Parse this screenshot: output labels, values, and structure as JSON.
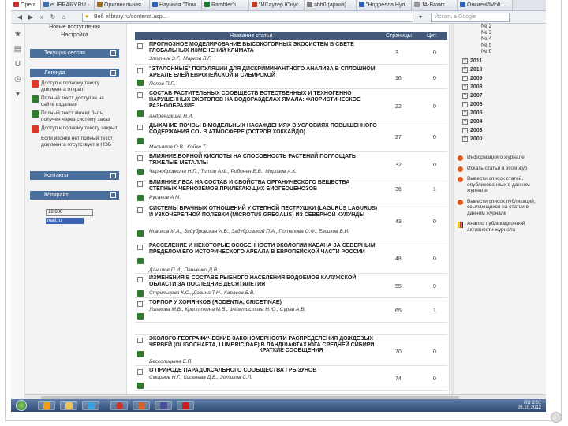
{
  "tabs": [
    {
      "label": "Opera",
      "color": "#d32f2f"
    },
    {
      "label": "eLIBRARY.RU -",
      "color": "#3b6fb6"
    },
    {
      "label": "Оригинальная...",
      "color": "#9c6b1f"
    },
    {
      "label": "Научная \"Тюм...",
      "color": "#2b63b8"
    },
    {
      "label": "Rambler's",
      "color": "#1b7d2e"
    },
    {
      "label": "\"ИСаутер Юнус...",
      "color": "#c23b22"
    },
    {
      "label": "abh0 (архив)...",
      "color": "#7a7a7a"
    },
    {
      "label": "\"Нодрелла Нул...",
      "color": "#2b63b8"
    },
    {
      "label": "JA-Вахит...",
      "color": "#999999"
    },
    {
      "label": "ОнкиенИМоlt ...",
      "color": "#2b63b8"
    }
  ],
  "toolbar": {
    "address_prefix": "Веб",
    "address": "elibrary.ru/contents.asp...",
    "search_placeholder": "Искать в Google"
  },
  "left_sidebar": {
    "top_links": [
      "Новые поступления",
      "Настройка"
    ],
    "panel_session": "Текущая сессия",
    "panel_legend": "Легенда",
    "legend_items": [
      {
        "text": "Доступ к полному тексту документа открыт",
        "color": "#d63a2a"
      },
      {
        "text": "Полный текст доступен на сайте издателя",
        "color": "#2f7a2f"
      },
      {
        "text": "Полный текст может быть получен через систему заказ",
        "color": "#2f7a2f"
      },
      {
        "text": "Доступ к полному тексту закрыт",
        "color": "#d63a2a"
      },
      {
        "text": "Если иконки нет полный текст документа отсутствует в НЭБ",
        "color": ""
      }
    ],
    "panel_contacts": "Контакты",
    "panel_copyright": "Копирайт",
    "counter_text": "18 808",
    "mailru_text": "mail.ru"
  },
  "table": {
    "col_title": "Название статьи",
    "col_pages": "Страницы",
    "col_citations": "Цит.",
    "rows": [
      {
        "title": "ПРОГНОЗНОЕ МОДЕЛИРОВАНИЕ ВЫСОКОГОРНЫХ ЭКОСИСТЕМ В СВЕТЕ ГЛОБАЛЬНЫХ ИЗМЕНЕНИЙ КЛИМАТА",
        "authors": "Злотник Э.Г., Марков Л.Г.",
        "pages": "3",
        "citations": "0"
      },
      {
        "title": "\"ЭТАЛОННЫЕ\" ПОПУЛЯЦИИ ДЛЯ ДИСКРИМИНАНТНОГО АНАЛИЗА В СПЛОШНОМ АРЕАЛЕ ЕЛЕЙ ЕВРОПЕЙСКОЙ И СИБИРСКОЙ",
        "authors": "Попов П.П.",
        "pages": "16",
        "citations": "0"
      },
      {
        "title": "СОСТАВ РАСТИТЕЛЬНЫХ СООБЩЕСТВ ЕСТЕСТВЕННЫХ И ТЕХНОГЕННО НАРУШЕННЫХ ЭКОТОПОВ НА ВОДОРАЗДЕЛАХ ЯМАЛА: ФЛОРИСТИЧЕСКОЕ РАЗНООБРАЗИЕ",
        "authors": "Андреяшкина Н.И.",
        "pages": "22",
        "citations": "0"
      },
      {
        "title": "ДЫХАНИЕ ПОЧВЫ В МОДЕЛЬНЫХ НАСАЖДЕНИЯХ В УСЛОВИЯХ ПОВЫШЕННОГО СОДЕРЖАНИЯ CO₂ В АТМОСФЕРЕ (ОСТРОВ ХОККАЙДО)",
        "authors": "Масьянов О.В., Койке Т.",
        "pages": "27",
        "citations": "0"
      },
      {
        "title": "ВЛИЯНИЕ БОРНОЙ КИСЛОТЫ НА СПОСОБНОСТЬ РАСТЕНИЙ ПОГЛОЩАТЬ ТЯЖЕЛЫЕ МЕТАЛЛЫ",
        "authors": "Чернобровкина Н.П., Титов А.Ф., Робонен Е.В., Морозов А.К.",
        "pages": "32",
        "citations": "0"
      },
      {
        "title": "ВЛИЯНИЕ ЛЕСА НА СОСТАВ И СВОЙСТВА ОРГАНИЧЕСКОГО ВЕЩЕСТВА СТЕПНЫХ ЧЕРНОЗЕМОВ ПРИЛЕГАЮЩИХ БИОГЕОЦЕНОЗОВ",
        "authors": "Русанов А.М.",
        "pages": "36",
        "citations": "1"
      },
      {
        "title": "СИСТЕМЫ БРАЧНЫХ ОТНОШЕНИЙ У СТЕПНОЙ ПЕСТРУШКИ (LAGURUS LAGURUS) И УЗКОЧЕРЕПНОЙ ПОЛЕВКИ (MICROTUS GREGALIS) ИЗ СЕВЕРНОЙ КУЛУНДЫ",
        "authors": "Новиков М.А., Задубровская И.В., Задубровский П.А., Потапова О.Ф., Евсиков В.И.",
        "pages": "43",
        "citations": "0"
      },
      {
        "title": "РАССЕЛЕНИЕ И НЕКОТОРЫЕ ОСОБЕННОСТИ ЭКОЛОГИИ КАБАНА ЗА СЕВЕРНЫМ ПРЕДЕЛОМ ЕГО ИСТОРИЧЕСКОГО АРЕАЛА В ЕВРОПЕЙСКОЙ ЧАСТИ РОССИИ",
        "authors": "Данилов П.И., Панченко Д.В.",
        "pages": "48",
        "citations": "0"
      },
      {
        "title": "ИЗМЕНЕНИЯ В СОСТАВЕ РЫБНОГО НАСЕЛЕНИЯ ВОДОЕМОВ КАЛУЖСКОЙ ОБЛАСТИ ЗА ПОСЛЕДНИЕ ДЕСЯТИЛЕТИЯ",
        "authors": "Стрельцова К.С., Дэвина Т.Н., Карасев В.В.",
        "pages": "55",
        "citations": "0"
      },
      {
        "title": "ТОРПОР У ХОМЯЧКОВ (RODENTIA, CRICETINAE)",
        "authors": "Ушакова М.В., Кропоткина М.В., Феоктистова Н.Ю., Сурав А.В.",
        "pages": "65",
        "citations": "1"
      },
      {
        "title": "ЭКОЛОГО-ГЕОГРАФИЧЕСКИЕ ЗАКОНОМЕРНОСТИ РАСПРЕДЕЛЕНИЯ ДОЖДЕВЫХ ЧЕРВЕЙ (OLIGOCHAETA, LUMBRICIDAE) В ЛАНДШАФТАХ ЮГА СРЕДНЕЙ СИБИРИ",
        "authors": "Бессолицына Е.П.",
        "pages": "70",
        "citations": "0"
      },
      {
        "title": "О ПРИРОДЕ ПАРАДОКСАЛЬНОГО СООБЩЕСТВА ГРЫЗУНОВ",
        "authors": "Смирнов Н.Г., Киселева Д.В., Зотиков С.Л.",
        "pages": "74",
        "citations": "0"
      }
    ],
    "section_short": "КРАТКИЕ СООБЩЕНИЯ"
  },
  "right_sidebar": {
    "issues": [
      "№ 2",
      "№ 3",
      "№ 4",
      "№ 5",
      "№ 6"
    ],
    "years": [
      "2011",
      "2010",
      "2009",
      "2008",
      "2007",
      "2006",
      "2005",
      "2004",
      "2003",
      "2000"
    ],
    "links": [
      {
        "text": "Информация о журнале",
        "icon": "dot"
      },
      {
        "text": "Искать статьи в этом жур",
        "icon": "dot"
      },
      {
        "text": "Вывести список статей, опубликованных в данном журнале",
        "icon": "dot"
      },
      {
        "text": "Вывести список публикаций, ссылающихся на статьи в данном журнале",
        "icon": "dot"
      },
      {
        "text": "Анализ публикационной активности журнала",
        "icon": "bars"
      }
    ]
  },
  "taskbar": {
    "time": "2:01",
    "date": "26.10.2012",
    "lang": "RU"
  }
}
